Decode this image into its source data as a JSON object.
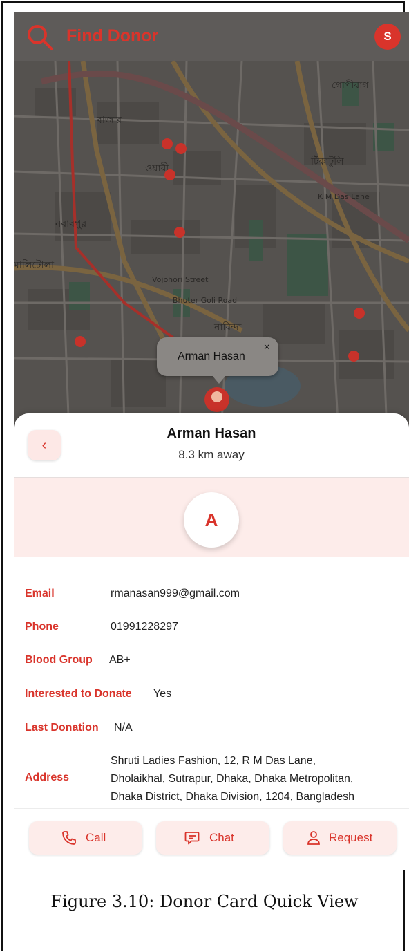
{
  "header": {
    "title": "Find Donor",
    "avatar_initial": "S"
  },
  "map_popup": {
    "name": "Arman Hasan",
    "close": "×"
  },
  "card": {
    "name": "Arman Hasan",
    "distance": "8.3 km away",
    "avatar_initial": "A",
    "back": "‹",
    "fields": {
      "email_label": "Email",
      "email": "rmanasan999@gmail.com",
      "phone_label": "Phone",
      "phone": "01991228297",
      "blood_label": "Blood Group",
      "blood": "AB+",
      "interested_label": "Interested to Donate",
      "interested": "Yes",
      "last_label": "Last Donation",
      "last": "N/A",
      "address_label": "Address",
      "address_line1": "Shruti Ladies Fashion, 12, R M Das Lane,",
      "address_line2": "Dholaikhal, Sutrapur, Dhaka, Dhaka Metropolitan,",
      "address_line3": "Dhaka District, Dhaka Division, 1204, Bangladesh"
    },
    "actions": {
      "call": "Call",
      "chat": "Chat",
      "request": "Request"
    }
  },
  "caption": "Figure 3.10: Donor Card Quick View",
  "colors": {
    "accent": "#d9342b",
    "soft": "#fdecea",
    "overlay": "#5b5753"
  }
}
